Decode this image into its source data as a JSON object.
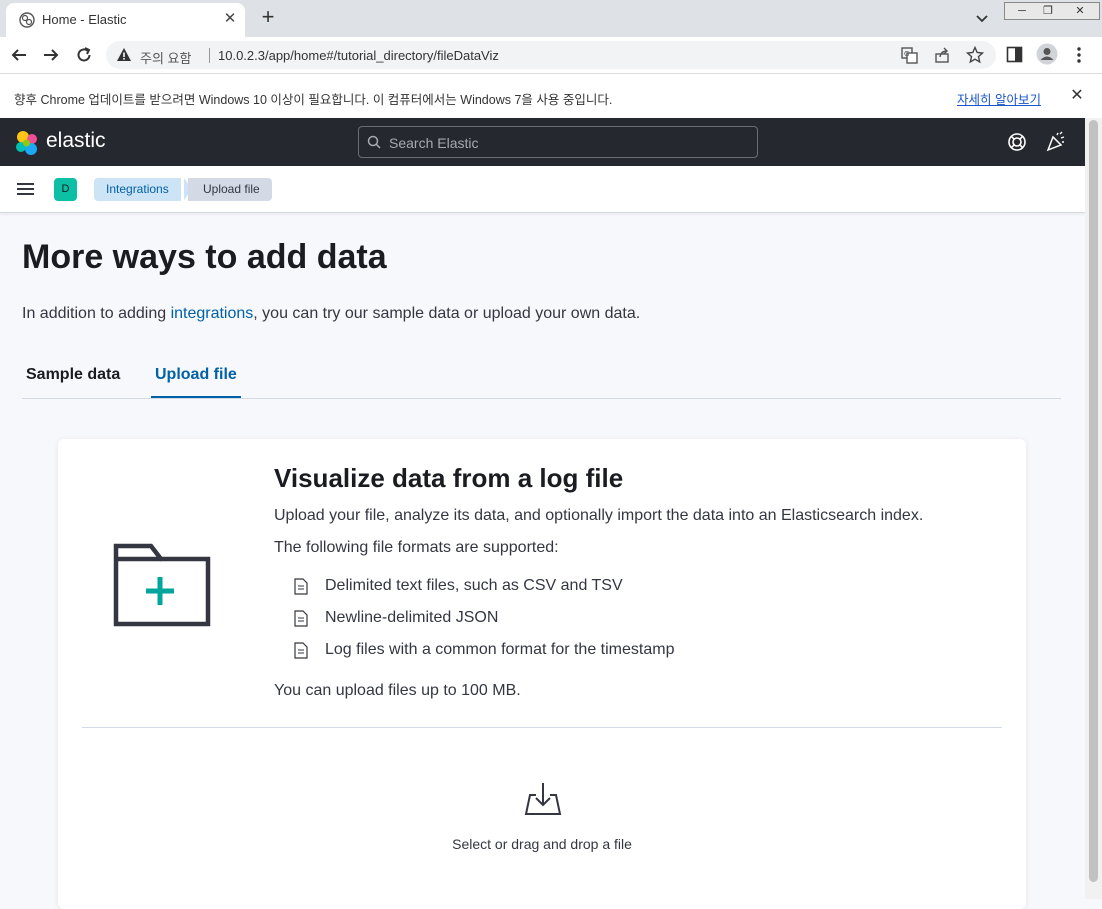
{
  "browser": {
    "tab_title": "Home - Elastic",
    "new_tab_glyph": "+",
    "close_glyph": "✕",
    "security_label": "주의 요함",
    "url": "10.0.2.3/app/home#/tutorial_directory/fileDataViz",
    "window_controls": [
      "─",
      "❐",
      "✕"
    ]
  },
  "infobar": {
    "message": "향후 Chrome 업데이트를 받으려면 Windows 10 이상이 필요합니다. 이 컴퓨터에서는 Windows 7을 사용 중입니다.",
    "link": "자세히 알아보기",
    "close_glyph": "✕"
  },
  "header": {
    "brand": "elastic",
    "search_placeholder": "Search Elastic"
  },
  "breadcrumb": {
    "space_initial": "D",
    "items": [
      "Integrations",
      "Upload file"
    ]
  },
  "main": {
    "title": "More ways to add data",
    "intro_prefix": "In addition to adding ",
    "intro_link": "integrations",
    "intro_suffix": ", you can try our sample data or upload your own data.",
    "tabs": [
      {
        "label": "Sample data",
        "selected": false
      },
      {
        "label": "Upload file",
        "selected": true
      }
    ]
  },
  "panel": {
    "title": "Visualize data from a log file",
    "description": "Upload your file, analyze its data, and optionally import the data into an Elasticsearch index.",
    "formats_intro": "The following file formats are supported:",
    "formats": [
      "Delimited text files, such as CSV and TSV",
      "Newline-delimited JSON",
      "Log files with a common format for the timestamp"
    ],
    "limit": "You can upload files up to 100 MB.",
    "upload_prompt": "Select or drag and drop a file"
  },
  "colors": {
    "accent": "#0061a6",
    "header_bg": "#25282f",
    "space_badge": "#0dbfa5",
    "folder_plus": "#00a69b"
  }
}
